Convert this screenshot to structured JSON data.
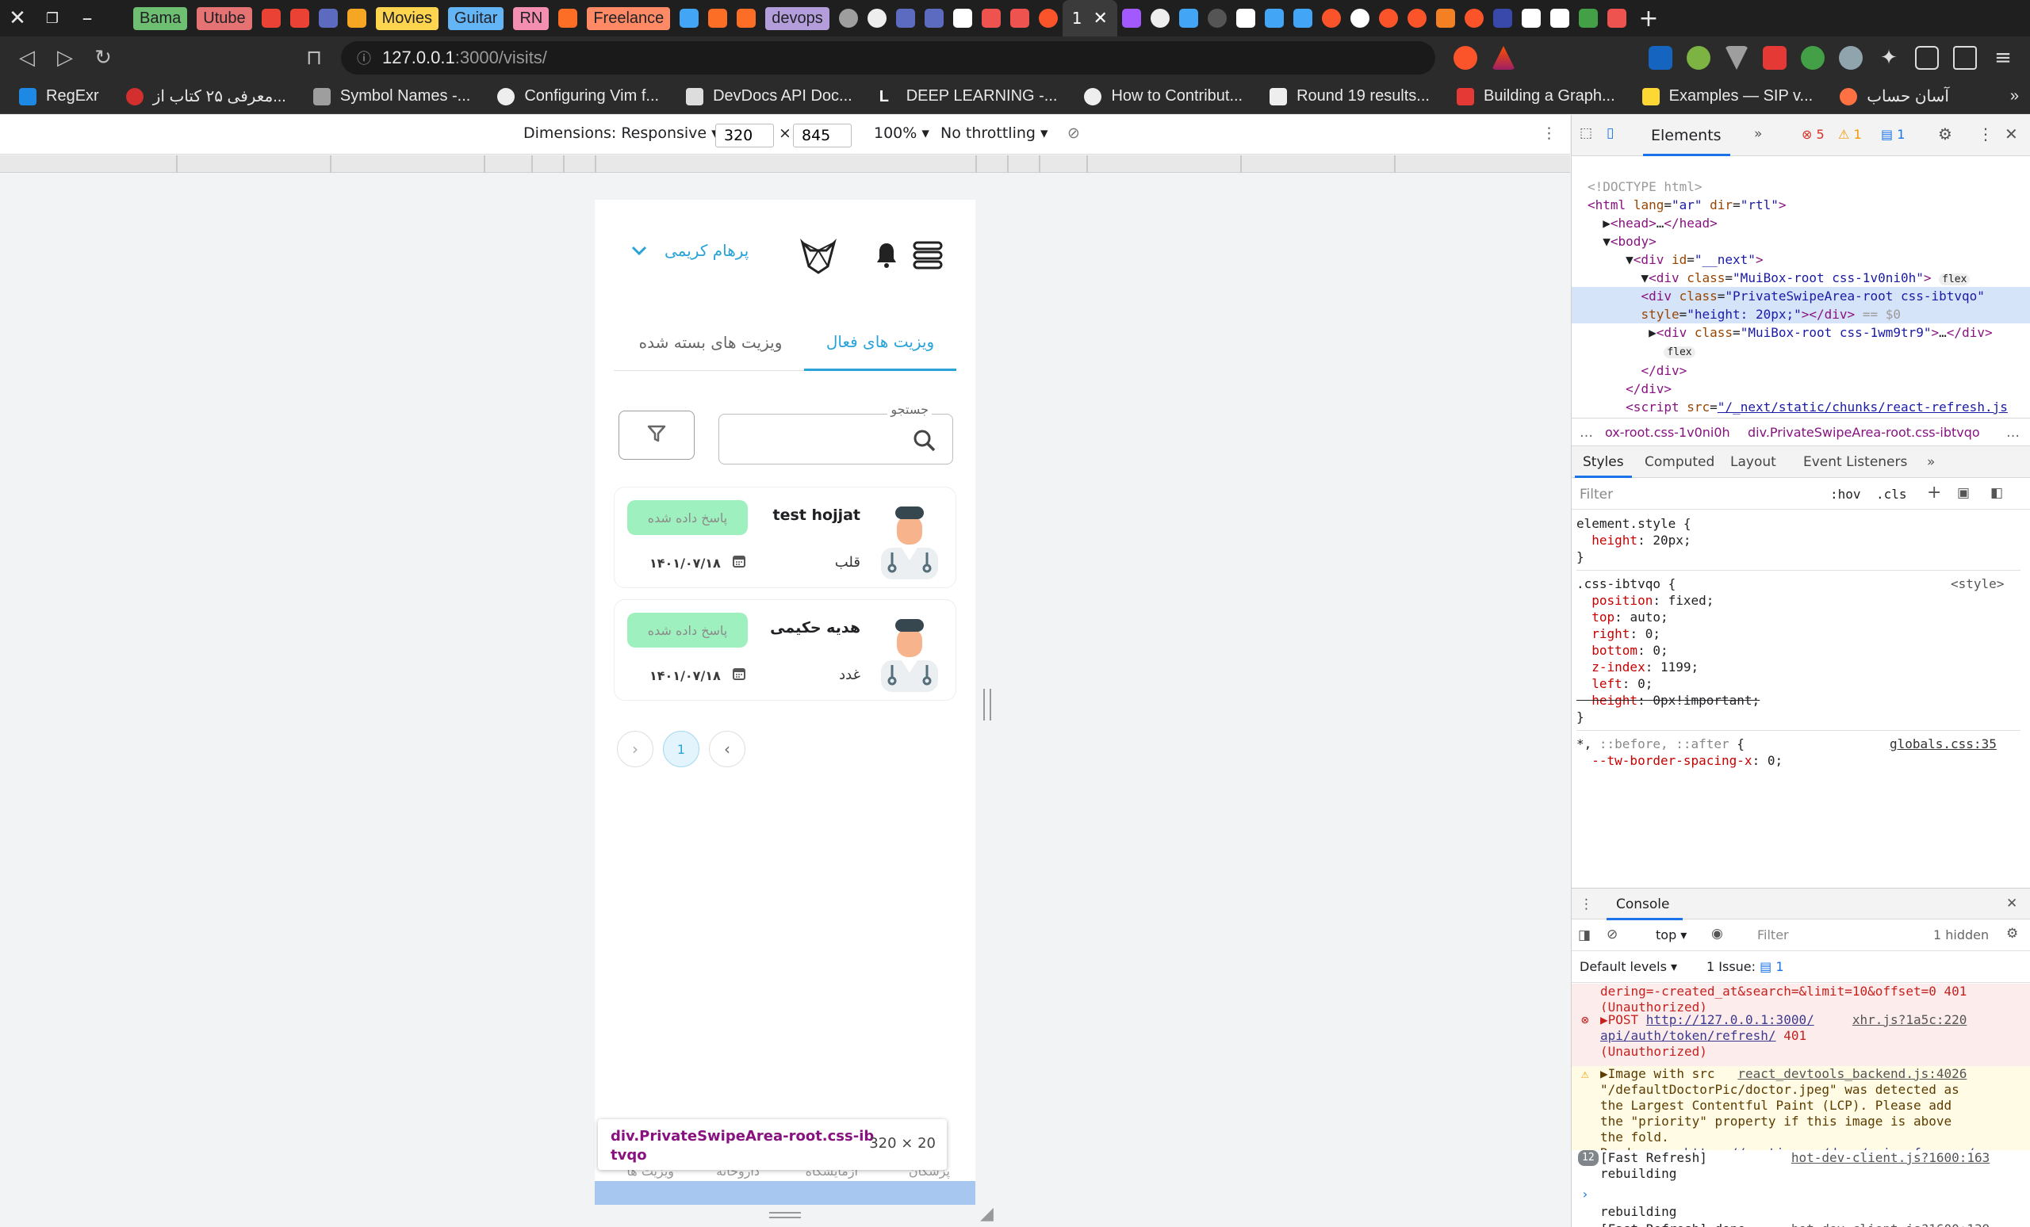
{
  "browser": {
    "tabs": [
      {
        "label": "Bama",
        "color": "#6fbf73"
      },
      {
        "label": "Utube",
        "color": "#e57373"
      },
      {
        "label": "Movies",
        "color": "#ffd54f"
      },
      {
        "label": "Guitar",
        "color": "#64b5f6"
      },
      {
        "label": "RN",
        "color": "#f48fb1"
      },
      {
        "label": "Freelance",
        "color": "#ff8a65"
      },
      {
        "label": "devops",
        "color": "#b39ddb"
      },
      {
        "label": "1",
        "color": ""
      }
    ],
    "url_host": "127.0.0.1",
    "url_rest": ":3000/visits/",
    "bookmarks": [
      "RegExr",
      "معرفی ۲۵ کتاب از...",
      "Symbol Names -...",
      "Configuring Vim f...",
      "DevDocs API Doc...",
      "DEEP LEARNING -...",
      "How to Contribut...",
      "Round 19 results...",
      "Building a Graph...",
      "Examples — SIP v...",
      "آسان حساب"
    ]
  },
  "device_toolbar": {
    "dimensions_label": "Dimensions: Responsive",
    "width": "320",
    "height": "845",
    "times": "×",
    "zoom": "100%",
    "throttling": "No throttling"
  },
  "app": {
    "user_name": "پرهام کریمی",
    "tabs": {
      "active": "ویزیت های فعال",
      "closed": "ویزیت های بسته شده"
    },
    "search_label": "جستجو",
    "visits": [
      {
        "name": "test hojjat",
        "specialty": "قلب",
        "date": "۱۴۰۱/۰۷/۱۸",
        "status": "پاسخ داده شده"
      },
      {
        "name": "هدیه حکیمی",
        "specialty": "غدد",
        "date": "۱۴۰۱/۰۷/۱۸",
        "status": "پاسخ داده شده"
      }
    ],
    "pagination": {
      "current": "1"
    },
    "bottom_nav": [
      "پزشکان",
      "آزمایشگاه",
      "داروخانه",
      "ویزیت ها"
    ],
    "tooltip": {
      "selector": "div.PrivateSwipeArea-root.css-ibtvqo",
      "size": "320 × 20"
    }
  },
  "devtools": {
    "tabs": [
      "Elements"
    ],
    "error_count": "5",
    "warning_count": "1",
    "info_count": "1",
    "breadcrumbs": [
      "ox-root.css-1v0ni0h",
      "div.PrivateSwipeArea-root.css-ibtvqo"
    ],
    "style_tabs": [
      "Styles",
      "Computed",
      "Layout",
      "Event Listeners"
    ],
    "filter_placeholder": "Filter",
    "hov": ":hov",
    "cls": ".cls",
    "console_title": "Console",
    "console_context": "top",
    "hidden": "1 hidden",
    "default_levels": "Default levels",
    "issues": "1 Issue:",
    "issues_count": "1"
  }
}
